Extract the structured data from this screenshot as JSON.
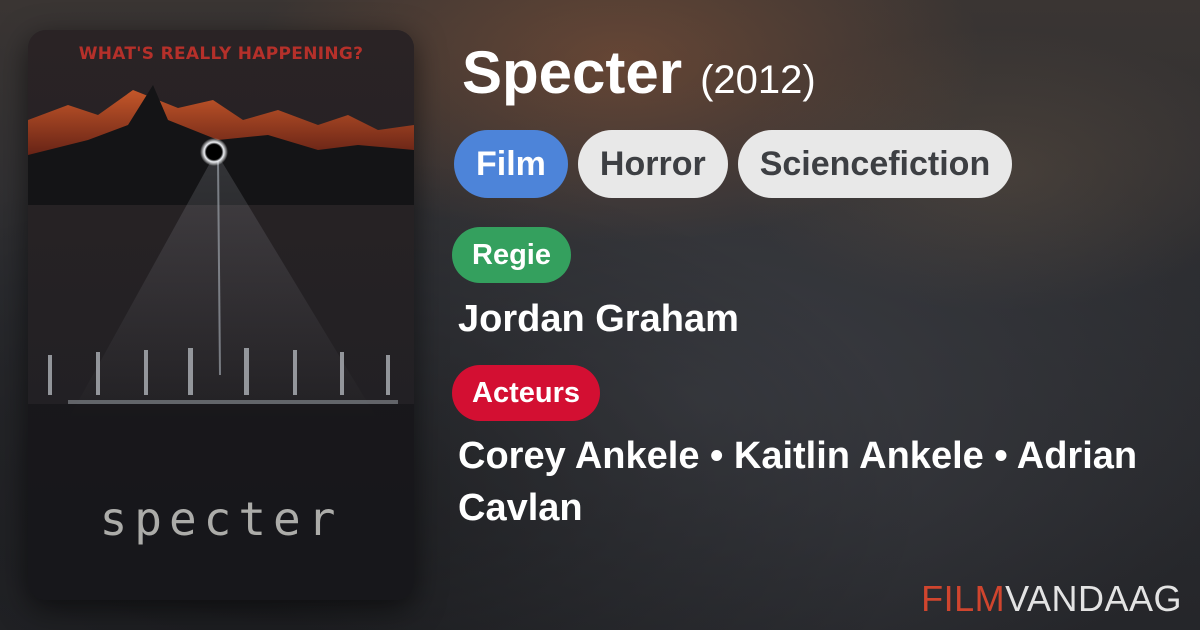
{
  "poster": {
    "tagline": "WHAT'S REALLY HAPPENING?",
    "title_art": "specter"
  },
  "movie": {
    "title": "Specter",
    "year": "(2012)"
  },
  "genres": [
    "Film",
    "Horror",
    "Sciencefiction"
  ],
  "sections": {
    "director_label": "Regie",
    "director": "Jordan Graham",
    "cast_label": "Acteurs",
    "cast": "Corey Ankele • Kaitlin Ankele • Adrian Cavlan"
  },
  "brand": {
    "part1": "FILM",
    "part2": "VANDAAG"
  },
  "colors": {
    "genre_primary": "#4d84d9",
    "genre_default": "#e8e8e8",
    "regie": "#34a05e",
    "acteurs": "#d30f32",
    "brand_accent": "#d0452e"
  }
}
